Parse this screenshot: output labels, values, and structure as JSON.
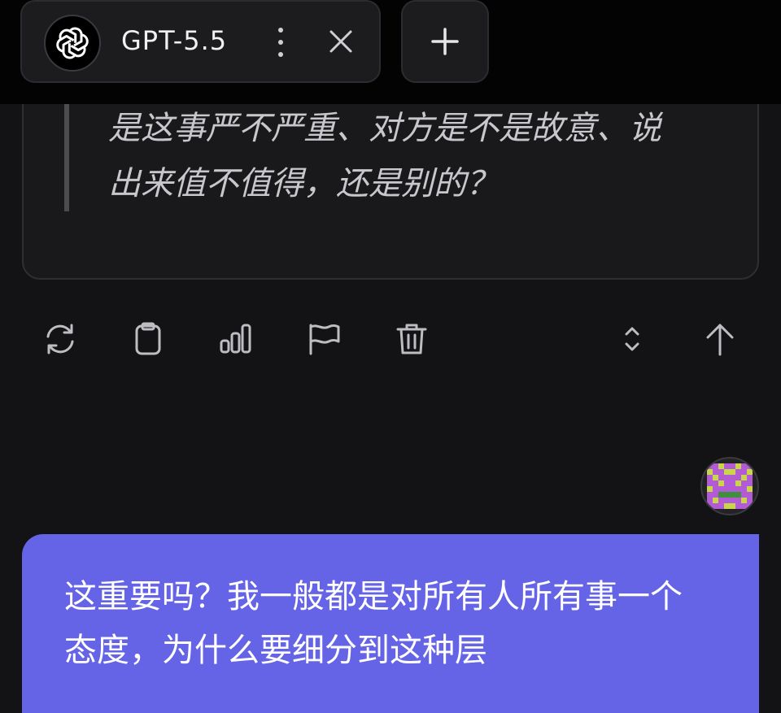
{
  "tab": {
    "model_name": "GPT-5.5",
    "logo_icon": "openai-logo-icon",
    "menu_icon": "more-vertical-icon",
    "close_icon": "close-icon"
  },
  "new_tab": {
    "icon": "plus-icon"
  },
  "assistant_message": {
    "quote_text": "是这事严不严重、对方是不是故意、说出来值不值得，还是别的？"
  },
  "actions": [
    {
      "name": "regenerate",
      "icon": "refresh-icon"
    },
    {
      "name": "copy",
      "icon": "clipboard-icon"
    },
    {
      "name": "stats",
      "icon": "bar-chart-icon"
    },
    {
      "name": "report",
      "icon": "flag-icon"
    },
    {
      "name": "delete",
      "icon": "trash-icon"
    },
    {
      "name": "expand",
      "icon": "chevron-up-down-icon"
    },
    {
      "name": "scroll-top",
      "icon": "arrow-up-icon"
    }
  ],
  "user": {
    "avatar_icon": "pixel-avatar-icon",
    "message_text": "这重要吗？我一般都是对所有人所有事一个态度，为什么要细分到这种层"
  },
  "colors": {
    "topbar_bg": "#030303",
    "page_bg": "#131315",
    "card_bg": "#19191b",
    "user_bubble": "#6563e6"
  }
}
